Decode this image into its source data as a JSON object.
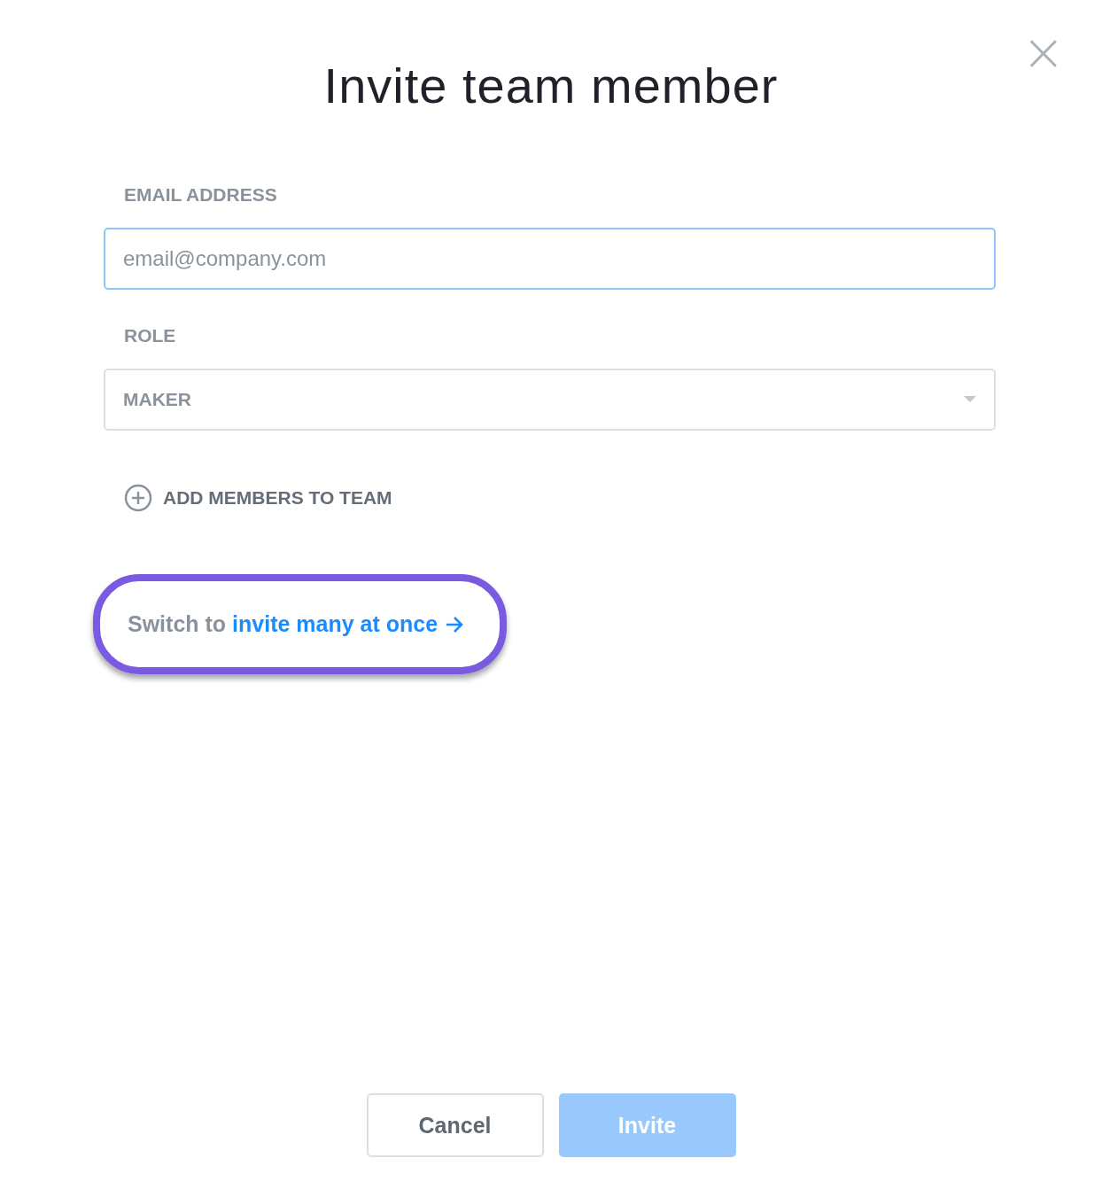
{
  "dialog": {
    "title": "Invite team member",
    "close": "×"
  },
  "email": {
    "label": "EMAIL ADDRESS",
    "placeholder": "email@company.com",
    "focused": true
  },
  "role": {
    "label": "ROLE",
    "value": "MAKER"
  },
  "add_members": {
    "label": "ADD MEMBERS TO TEAM"
  },
  "switch": {
    "prefix": "Switch to",
    "link": "invite many at once",
    "highlighted": true
  },
  "buttons": [
    {
      "label": "Cancel",
      "kind": "secondary",
      "disabled": false
    },
    {
      "label": "Invite",
      "kind": "primary",
      "disabled": true
    }
  ]
}
